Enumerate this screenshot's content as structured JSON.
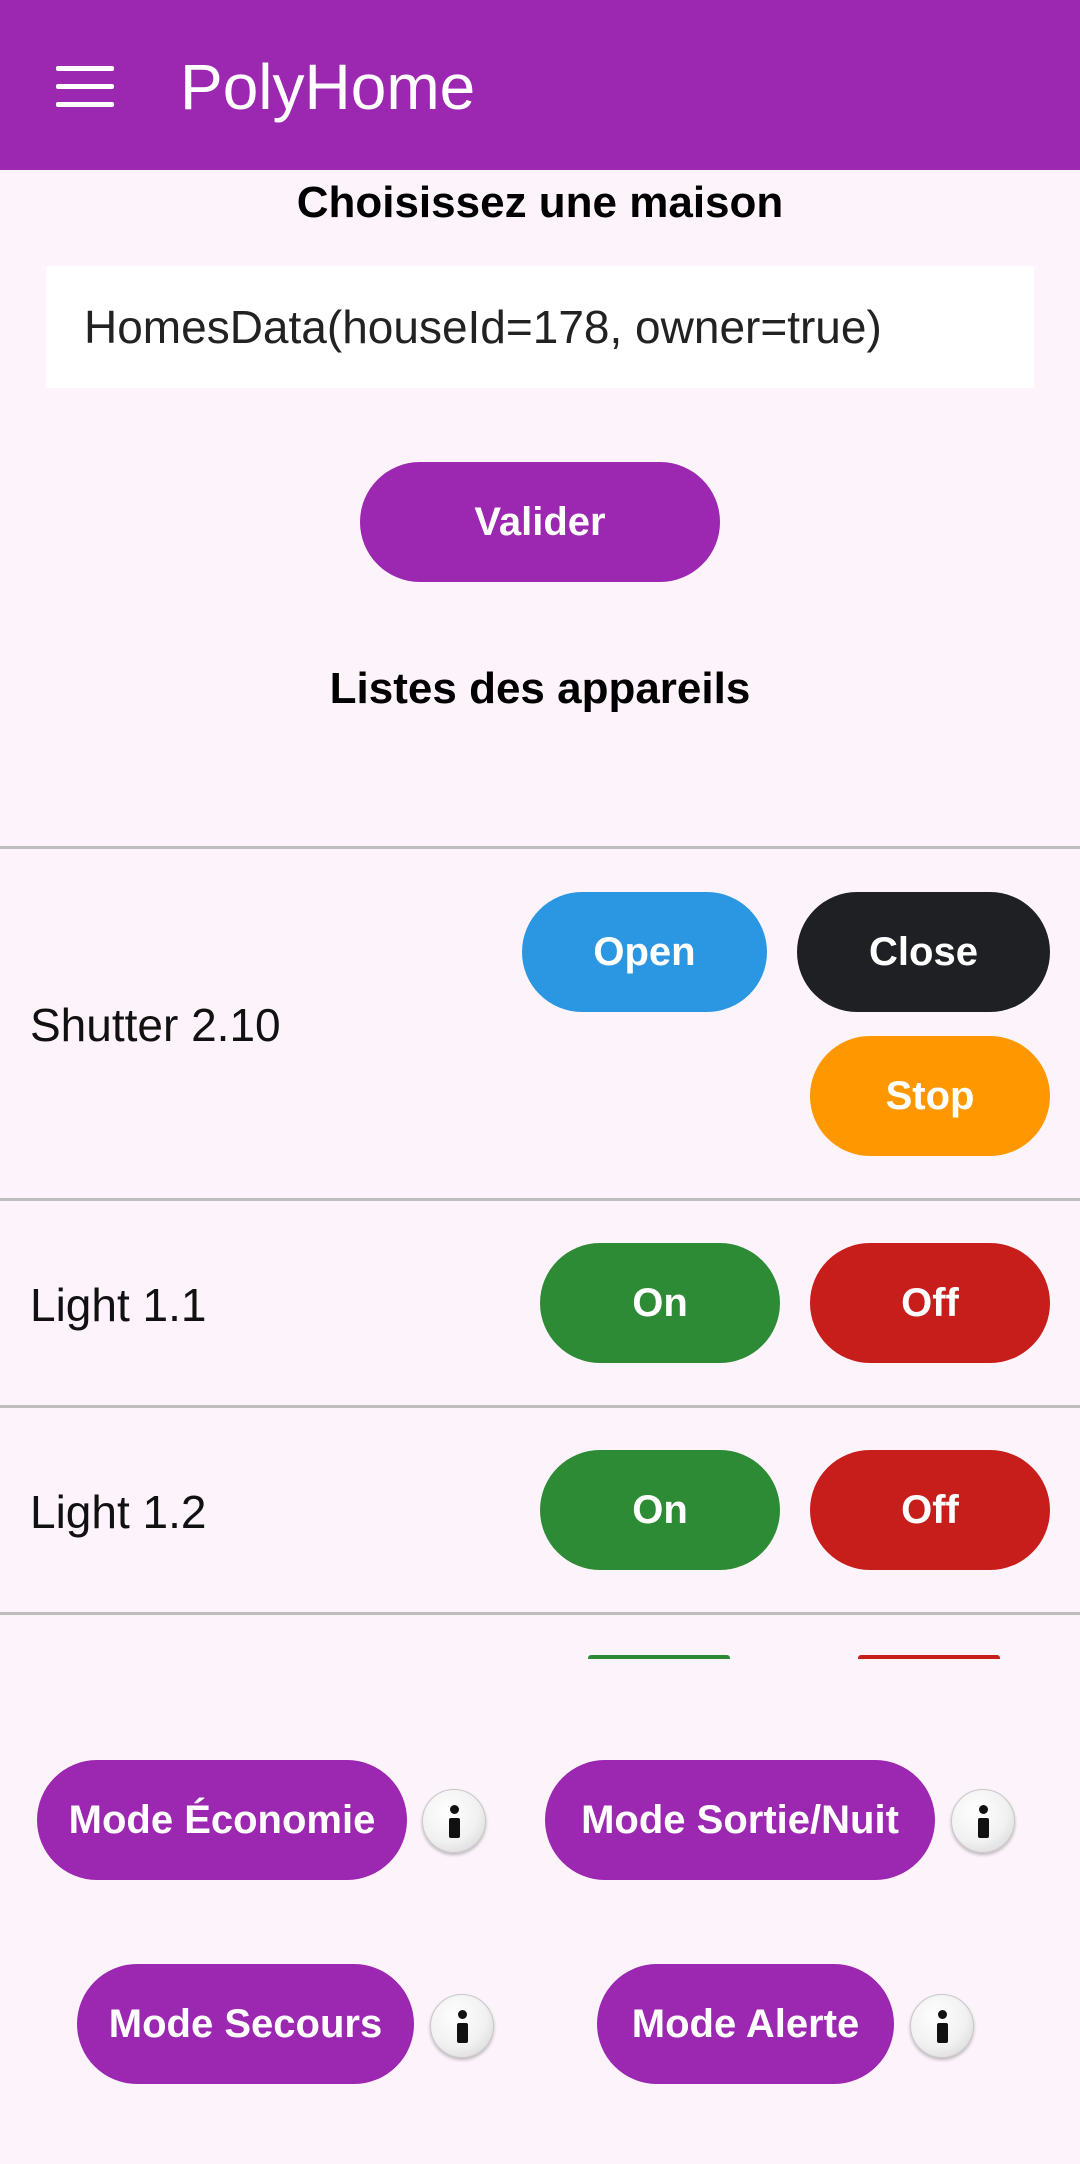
{
  "appbar": {
    "title": "PolyHome",
    "menu_icon": "menu-icon"
  },
  "house": {
    "heading": "Choisissez une maison",
    "selected": "HomesData(houseId=178, owner=true)",
    "validate_label": "Valider"
  },
  "devices": {
    "heading": "Listes des appareils",
    "shutter": {
      "name": "Shutter 2.10",
      "open_label": "Open",
      "close_label": "Close",
      "stop_label": "Stop"
    },
    "lights": [
      {
        "name": "Light 1.1",
        "on_label": "On",
        "off_label": "Off"
      },
      {
        "name": "Light 1.2",
        "on_label": "On",
        "off_label": "Off"
      }
    ]
  },
  "modes": {
    "economy": "Mode Économie",
    "exit_night": "Mode Sortie/Nuit",
    "rescue": "Mode Secours",
    "alert": "Mode Alerte",
    "info_icon": "info-icon"
  },
  "colors": {
    "primary": "#9c27b0",
    "open": "#2b97e2",
    "close": "#1e2023",
    "stop": "#ff9800",
    "on": "#2e8b35",
    "off": "#c81e1b",
    "background": "#fdf4fb"
  }
}
